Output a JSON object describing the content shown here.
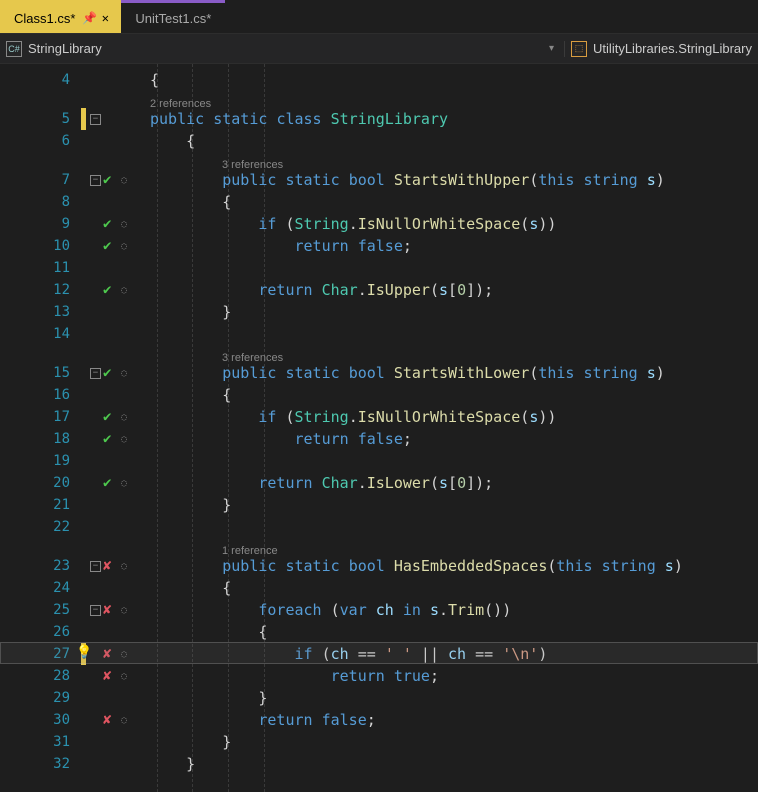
{
  "tabs": [
    {
      "label": "Class1.cs*",
      "active": true,
      "pinned": true
    },
    {
      "label": "UnitTest1.cs*",
      "active": false
    }
  ],
  "nav": {
    "left": "StringLibrary",
    "right": "UtilityLibraries.StringLibrary",
    "left_icon": "C#"
  },
  "lines": [
    {
      "n": 4,
      "fold": false,
      "test": "",
      "change": "",
      "extra": 0,
      "tokens": [
        [
          "punc",
          "{"
        ]
      ]
    },
    {
      "n": 5,
      "fold": true,
      "test": "",
      "change": "yellow",
      "extra": 17,
      "lens": "2 references",
      "tokens": [
        [
          "kw",
          "public"
        ],
        [
          "op",
          " "
        ],
        [
          "kw",
          "static"
        ],
        [
          "op",
          " "
        ],
        [
          "kw",
          "class"
        ],
        [
          "op",
          " "
        ],
        [
          "type",
          "StringLibrary"
        ]
      ]
    },
    {
      "n": 6,
      "fold": false,
      "test": "",
      "change": "",
      "extra": 0,
      "tokens": [
        [
          "punc",
          "    {"
        ]
      ]
    },
    {
      "n": 7,
      "fold": true,
      "test": "pass",
      "change": "",
      "extra": 17,
      "lens": "3 references",
      "tokens": [
        [
          "op",
          "        "
        ],
        [
          "kw",
          "public"
        ],
        [
          "op",
          " "
        ],
        [
          "kw",
          "static"
        ],
        [
          "op",
          " "
        ],
        [
          "kw",
          "bool"
        ],
        [
          "op",
          " "
        ],
        [
          "method",
          "StartsWithUpper"
        ],
        [
          "punc",
          "("
        ],
        [
          "kw",
          "this"
        ],
        [
          "op",
          " "
        ],
        [
          "kw",
          "string"
        ],
        [
          "op",
          " "
        ],
        [
          "param",
          "s"
        ],
        [
          "punc",
          ")"
        ]
      ]
    },
    {
      "n": 8,
      "fold": false,
      "test": "",
      "change": "",
      "extra": 0,
      "tokens": [
        [
          "punc",
          "        {"
        ]
      ]
    },
    {
      "n": 9,
      "fold": false,
      "test": "pass",
      "change": "",
      "extra": 0,
      "tokens": [
        [
          "op",
          "            "
        ],
        [
          "kw",
          "if"
        ],
        [
          "op",
          " "
        ],
        [
          "punc",
          "("
        ],
        [
          "type",
          "String"
        ],
        [
          "punc",
          "."
        ],
        [
          "method",
          "IsNullOrWhiteSpace"
        ],
        [
          "punc",
          "("
        ],
        [
          "param",
          "s"
        ],
        [
          "punc",
          "))"
        ]
      ]
    },
    {
      "n": 10,
      "fold": false,
      "test": "pass",
      "change": "",
      "extra": 0,
      "tokens": [
        [
          "op",
          "                "
        ],
        [
          "kw",
          "return"
        ],
        [
          "op",
          " "
        ],
        [
          "kw",
          "false"
        ],
        [
          "punc",
          ";"
        ]
      ]
    },
    {
      "n": 11,
      "fold": false,
      "test": "",
      "change": "",
      "extra": 0,
      "tokens": [
        [
          "op",
          ""
        ]
      ]
    },
    {
      "n": 12,
      "fold": false,
      "test": "pass",
      "change": "",
      "extra": 0,
      "tokens": [
        [
          "op",
          "            "
        ],
        [
          "kw",
          "return"
        ],
        [
          "op",
          " "
        ],
        [
          "type",
          "Char"
        ],
        [
          "punc",
          "."
        ],
        [
          "method",
          "IsUpper"
        ],
        [
          "punc",
          "("
        ],
        [
          "param",
          "s"
        ],
        [
          "punc",
          "["
        ],
        [
          "lit",
          "0"
        ],
        [
          "punc",
          "]);"
        ]
      ]
    },
    {
      "n": 13,
      "fold": false,
      "test": "",
      "change": "",
      "extra": 0,
      "tokens": [
        [
          "punc",
          "        }"
        ]
      ]
    },
    {
      "n": 14,
      "fold": false,
      "test": "",
      "change": "",
      "extra": 0,
      "tokens": [
        [
          "op",
          ""
        ]
      ]
    },
    {
      "n": 15,
      "fold": true,
      "test": "pass",
      "change": "",
      "extra": 17,
      "lens": "3 references",
      "tokens": [
        [
          "op",
          "        "
        ],
        [
          "kw",
          "public"
        ],
        [
          "op",
          " "
        ],
        [
          "kw",
          "static"
        ],
        [
          "op",
          " "
        ],
        [
          "kw",
          "bool"
        ],
        [
          "op",
          " "
        ],
        [
          "method",
          "StartsWithLower"
        ],
        [
          "punc",
          "("
        ],
        [
          "kw",
          "this"
        ],
        [
          "op",
          " "
        ],
        [
          "kw",
          "string"
        ],
        [
          "op",
          " "
        ],
        [
          "param",
          "s"
        ],
        [
          "punc",
          ")"
        ]
      ]
    },
    {
      "n": 16,
      "fold": false,
      "test": "",
      "change": "",
      "extra": 0,
      "tokens": [
        [
          "punc",
          "        {"
        ]
      ]
    },
    {
      "n": 17,
      "fold": false,
      "test": "pass",
      "change": "",
      "extra": 0,
      "tokens": [
        [
          "op",
          "            "
        ],
        [
          "kw",
          "if"
        ],
        [
          "op",
          " "
        ],
        [
          "punc",
          "("
        ],
        [
          "type",
          "String"
        ],
        [
          "punc",
          "."
        ],
        [
          "method",
          "IsNullOrWhiteSpace"
        ],
        [
          "punc",
          "("
        ],
        [
          "param",
          "s"
        ],
        [
          "punc",
          "))"
        ]
      ]
    },
    {
      "n": 18,
      "fold": false,
      "test": "pass",
      "change": "",
      "extra": 0,
      "tokens": [
        [
          "op",
          "                "
        ],
        [
          "kw",
          "return"
        ],
        [
          "op",
          " "
        ],
        [
          "kw",
          "false"
        ],
        [
          "punc",
          ";"
        ]
      ]
    },
    {
      "n": 19,
      "fold": false,
      "test": "",
      "change": "",
      "extra": 0,
      "tokens": [
        [
          "op",
          ""
        ]
      ]
    },
    {
      "n": 20,
      "fold": false,
      "test": "pass",
      "change": "",
      "extra": 0,
      "tokens": [
        [
          "op",
          "            "
        ],
        [
          "kw",
          "return"
        ],
        [
          "op",
          " "
        ],
        [
          "type",
          "Char"
        ],
        [
          "punc",
          "."
        ],
        [
          "method",
          "IsLower"
        ],
        [
          "punc",
          "("
        ],
        [
          "param",
          "s"
        ],
        [
          "punc",
          "["
        ],
        [
          "lit",
          "0"
        ],
        [
          "punc",
          "]);"
        ]
      ]
    },
    {
      "n": 21,
      "fold": false,
      "test": "",
      "change": "",
      "extra": 0,
      "tokens": [
        [
          "punc",
          "        }"
        ]
      ]
    },
    {
      "n": 22,
      "fold": false,
      "test": "",
      "change": "",
      "extra": 0,
      "tokens": [
        [
          "op",
          ""
        ]
      ]
    },
    {
      "n": 23,
      "fold": true,
      "test": "fail",
      "change": "",
      "extra": 17,
      "lens": "1 reference",
      "tokens": [
        [
          "op",
          "        "
        ],
        [
          "kw",
          "public"
        ],
        [
          "op",
          " "
        ],
        [
          "kw",
          "static"
        ],
        [
          "op",
          " "
        ],
        [
          "kw",
          "bool"
        ],
        [
          "op",
          " "
        ],
        [
          "method",
          "HasEmbeddedSpaces"
        ],
        [
          "punc",
          "("
        ],
        [
          "kw",
          "this"
        ],
        [
          "op",
          " "
        ],
        [
          "kw",
          "string"
        ],
        [
          "op",
          " "
        ],
        [
          "param",
          "s"
        ],
        [
          "punc",
          ")"
        ]
      ]
    },
    {
      "n": 24,
      "fold": false,
      "test": "",
      "change": "",
      "extra": 0,
      "tokens": [
        [
          "punc",
          "        {"
        ]
      ]
    },
    {
      "n": 25,
      "fold": true,
      "test": "fail",
      "change": "",
      "extra": 0,
      "tokens": [
        [
          "op",
          "            "
        ],
        [
          "kw",
          "foreach"
        ],
        [
          "op",
          " "
        ],
        [
          "punc",
          "("
        ],
        [
          "kw",
          "var"
        ],
        [
          "op",
          " "
        ],
        [
          "param",
          "ch"
        ],
        [
          "op",
          " "
        ],
        [
          "kw",
          "in"
        ],
        [
          "op",
          " "
        ],
        [
          "param",
          "s"
        ],
        [
          "punc",
          "."
        ],
        [
          "method",
          "Trim"
        ],
        [
          "punc",
          "())"
        ]
      ]
    },
    {
      "n": 26,
      "fold": false,
      "test": "",
      "change": "",
      "extra": 0,
      "tokens": [
        [
          "punc",
          "            {"
        ]
      ]
    },
    {
      "n": 27,
      "fold": false,
      "test": "fail",
      "change": "yellow",
      "extra": 0,
      "hl": true,
      "bulb": true,
      "tokens": [
        [
          "op",
          "                "
        ],
        [
          "kw",
          "if"
        ],
        [
          "op",
          " "
        ],
        [
          "punc",
          "("
        ],
        [
          "param",
          "ch"
        ],
        [
          "op",
          " == "
        ],
        [
          "str",
          "' '"
        ],
        [
          "op",
          " || "
        ],
        [
          "param",
          "ch"
        ],
        [
          "op",
          " == "
        ],
        [
          "str",
          "'\\n'"
        ],
        [
          "punc",
          ")"
        ]
      ]
    },
    {
      "n": 28,
      "fold": false,
      "test": "fail",
      "change": "",
      "extra": 0,
      "tokens": [
        [
          "op",
          "                    "
        ],
        [
          "kw",
          "return"
        ],
        [
          "op",
          " "
        ],
        [
          "kw",
          "true"
        ],
        [
          "punc",
          ";"
        ]
      ]
    },
    {
      "n": 29,
      "fold": false,
      "test": "",
      "change": "",
      "extra": 0,
      "tokens": [
        [
          "punc",
          "            }"
        ]
      ]
    },
    {
      "n": 30,
      "fold": false,
      "test": "fail",
      "change": "",
      "extra": 0,
      "tokens": [
        [
          "op",
          "            "
        ],
        [
          "kw",
          "return"
        ],
        [
          "op",
          " "
        ],
        [
          "kw",
          "false"
        ],
        [
          "punc",
          ";"
        ]
      ]
    },
    {
      "n": 31,
      "fold": false,
      "test": "",
      "change": "",
      "extra": 0,
      "tokens": [
        [
          "punc",
          "        }"
        ]
      ]
    },
    {
      "n": 32,
      "fold": false,
      "test": "",
      "change": "",
      "extra": 0,
      "tokens": [
        [
          "punc",
          "    }"
        ]
      ]
    }
  ]
}
